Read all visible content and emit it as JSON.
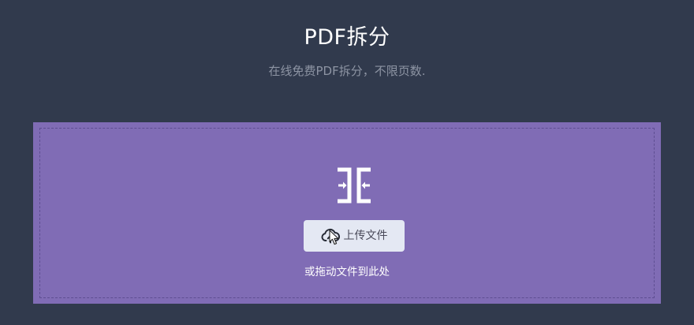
{
  "header": {
    "title": "PDF拆分",
    "subtitle": "在线免费PDF拆分，不限页数."
  },
  "dropzone": {
    "icon": "split-pages-icon",
    "upload_button_label": "上传文件",
    "upload_icon": "cloud-upload-icon",
    "drop_hint": "或拖动文件到此处"
  },
  "colors": {
    "background": "#313a4d",
    "dropzone": "#806cb5",
    "button": "#e4e8f3",
    "subtitle": "#8d94a3"
  }
}
